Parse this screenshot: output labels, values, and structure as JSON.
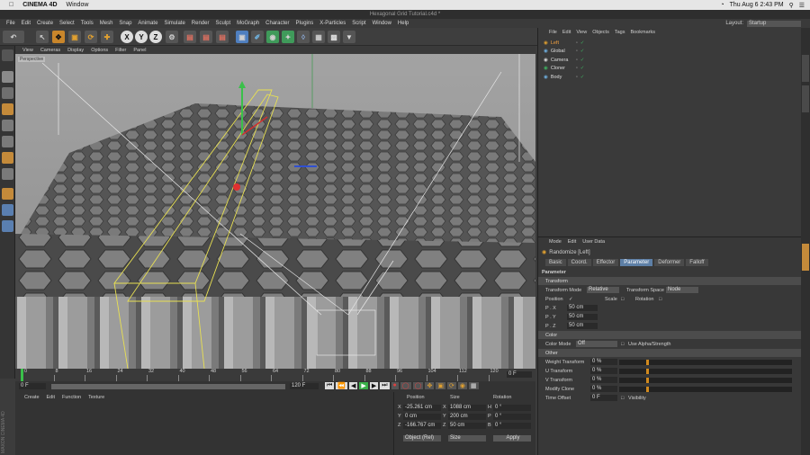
{
  "mac": {
    "app": "CINEMA 4D",
    "menu": "Window",
    "clock": "Thu Aug 6  2:43 PM"
  },
  "window_title": "Hexagonal Grid Tutorial.c4d *",
  "menus": [
    "File",
    "Edit",
    "Create",
    "Select",
    "Tools",
    "Mesh",
    "Snap",
    "Animate",
    "Simulate",
    "Render",
    "Sculpt",
    "MoGraph",
    "Character",
    "Plugins",
    "X-Particles",
    "Script",
    "Window",
    "Help"
  ],
  "layout": {
    "label": "Layout:",
    "value": "Startup"
  },
  "toolbar": {
    "axis_x": "X",
    "axis_y": "Y",
    "axis_z": "Z"
  },
  "viewport_menu": [
    "View",
    "Cameras",
    "Display",
    "Options",
    "Filter",
    "Panel"
  ],
  "viewport_label": "Perspective",
  "timeline": {
    "ticks": [
      "0",
      "8",
      "16",
      "24",
      "32",
      "40",
      "48",
      "56",
      "64",
      "72",
      "80",
      "88",
      "96",
      "104",
      "112",
      "120"
    ],
    "current_frame": "0 F"
  },
  "transport": {
    "start": "0 F",
    "end": "120 F",
    "current": "0 F"
  },
  "material_menu": [
    "Create",
    "Edit",
    "Function",
    "Texture"
  ],
  "coords": {
    "headers": [
      "Position",
      "Size",
      "Rotation"
    ],
    "rows": [
      {
        "axis": "X",
        "pos": "-25.261 cm",
        "size_axis": "X",
        "size": "1088 cm",
        "rot_axis": "H",
        "rot": "0 °"
      },
      {
        "axis": "Y",
        "pos": "0 cm",
        "size_axis": "Y",
        "size": "200 cm",
        "rot_axis": "P",
        "rot": "0 °"
      },
      {
        "axis": "Z",
        "pos": "-166.767 cm",
        "size_axis": "Z",
        "size": "50 cm",
        "rot_axis": "B",
        "rot": "0 °"
      }
    ],
    "mode": "Object (Rel)",
    "size_mode": "Size",
    "apply": "Apply"
  },
  "object_manager": {
    "menu": [
      "File",
      "Edit",
      "View",
      "Objects",
      "Tags",
      "Bookmarks"
    ],
    "objects": [
      {
        "name": "Left",
        "selected": true
      },
      {
        "name": "Global",
        "selected": false
      },
      {
        "name": "Camera",
        "selected": false
      },
      {
        "name": "Cloner",
        "selected": false
      },
      {
        "name": "Body",
        "selected": false
      }
    ]
  },
  "attributes": {
    "menu": [
      "Mode",
      "Edit",
      "User Data"
    ],
    "title": "Randomize [Left]",
    "tabs": [
      {
        "label": "Basic",
        "active": false
      },
      {
        "label": "Coord.",
        "active": false
      },
      {
        "label": "Effector",
        "active": false
      },
      {
        "label": "Parameter",
        "active": true
      },
      {
        "label": "Deformer",
        "active": false
      },
      {
        "label": "Falloff",
        "active": false
      }
    ],
    "section_parameter": "Parameter",
    "section_transform": "Transform",
    "transform_mode_label": "Transform Mode",
    "transform_mode_value": "Relative",
    "transform_space_label": "Transform Space",
    "transform_space_value": "Node",
    "position_label": "Position",
    "scale_label": "Scale",
    "rotation_label": "Rotation",
    "p_rows": [
      {
        "label": "P . X",
        "value": "50 cm"
      },
      {
        "label": "P . Y",
        "value": "50 cm"
      },
      {
        "label": "P . Z",
        "value": "50 cm"
      }
    ],
    "section_color": "Color",
    "color_mode_label": "Color Mode",
    "color_mode_value": "Off",
    "use_alpha_label": "Use Alpha/Strength",
    "section_other": "Other",
    "other_rows": [
      {
        "label": "Weight Transform",
        "value": "0 %"
      },
      {
        "label": "U Transform",
        "value": "0 %"
      },
      {
        "label": "V Transform",
        "value": "0 %"
      },
      {
        "label": "Modify Clone",
        "value": "0 %"
      },
      {
        "label": "Time Offset",
        "value": "0 F"
      }
    ],
    "visibility_label": "Visibility"
  },
  "brand": "MAXON CINEMA 4D"
}
